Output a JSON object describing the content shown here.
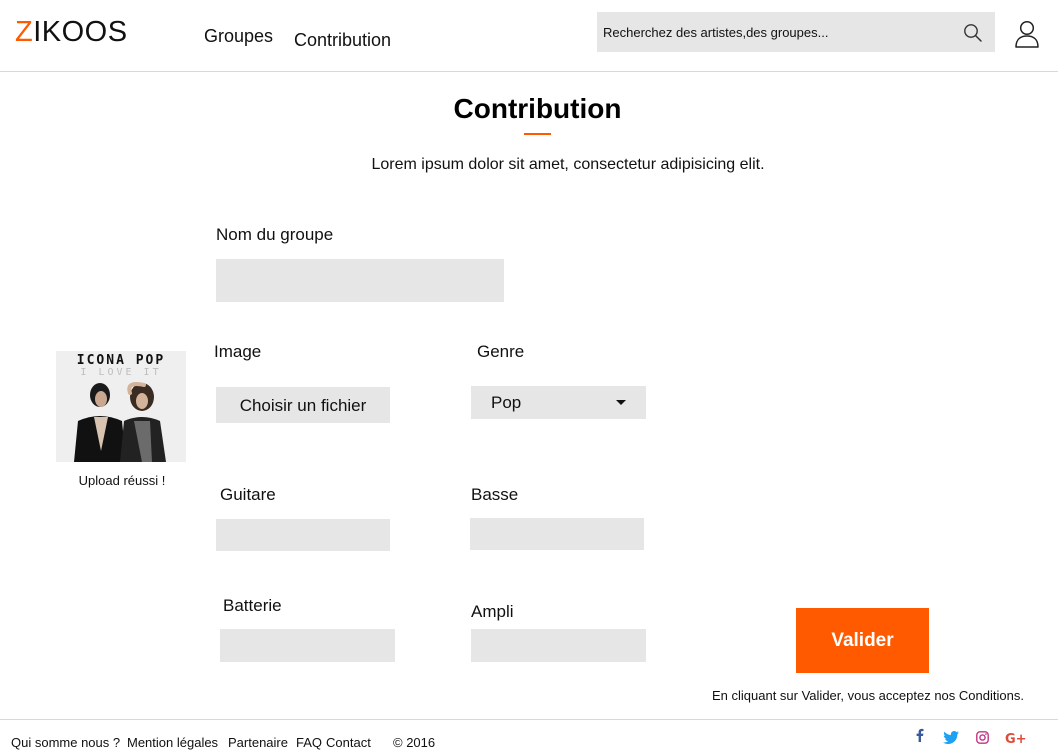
{
  "header": {
    "logo_first": "Z",
    "logo_rest": "IKOOS",
    "nav": [
      {
        "label": "Groupes"
      },
      {
        "label": "Contribution"
      }
    ],
    "search_placeholder": "Recherchez des artistes,des groupes..."
  },
  "main": {
    "title": "Contribution",
    "subtitle": "Lorem ipsum dolor sit amet, consectetur adipisicing elit.",
    "fields": {
      "group_name": {
        "label": "Nom du groupe",
        "value": ""
      },
      "image": {
        "label": "Image",
        "button": "Choisir un fichier"
      },
      "genre": {
        "label": "Genre",
        "value": "Pop"
      },
      "guitare": {
        "label": "Guitare",
        "value": ""
      },
      "basse": {
        "label": "Basse",
        "value": ""
      },
      "batterie": {
        "label": "Batterie",
        "value": ""
      },
      "ampli": {
        "label": "Ampli",
        "value": ""
      }
    },
    "preview": {
      "cover_text": "ICONA POP",
      "cover_subtext": "I LOVE IT",
      "status": "Upload réussi !"
    },
    "submit_label": "Valider",
    "terms": "En cliquant sur Valider, vous acceptez nos Conditions."
  },
  "footer": {
    "links": [
      "Qui somme nous ?",
      "Mention légales",
      "Partenaire",
      "FAQ",
      "Contact"
    ],
    "copyright": "© 2016",
    "social": [
      "facebook-icon",
      "twitter-icon",
      "instagram-icon",
      "google-plus-icon"
    ]
  },
  "colors": {
    "accent": "#ff5a00",
    "field_bg": "#e6e6e6",
    "facebook": "#3b5998",
    "twitter": "#1da1f2",
    "instagram": "#c13584",
    "google_plus": "#dd4b39"
  }
}
